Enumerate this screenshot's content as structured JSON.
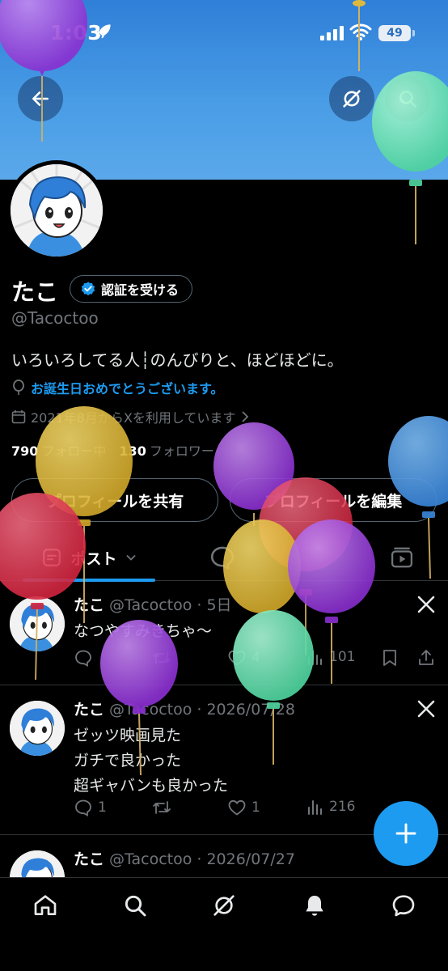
{
  "status": {
    "time": "1:03",
    "battery": "49"
  },
  "profile": {
    "name": "たこ",
    "verify_label": "認証を受ける",
    "handle": "@Tacoctoo",
    "bio": "いろいろしてる人┆のんびりと、ほどほどに。",
    "birthday": "お誕生日おめでとうございます。",
    "joined": "2021年8月からXを利用しています",
    "following_count": "790",
    "following_label": "フォロー中",
    "followers_count": "130",
    "followers_label": "フォロワー",
    "share_label": "プロフィールを共有",
    "edit_label": "プロフィールを編集"
  },
  "tabs": {
    "posts_label": "ポスト"
  },
  "tweets": [
    {
      "name": "たこ",
      "meta": "@Tacoctoo · 5日",
      "lines": [
        "なつやすみきちゃ〜"
      ],
      "views": "101",
      "likes": "4"
    },
    {
      "name": "たこ",
      "meta": "@Tacoctoo · 2026/07/28",
      "lines": [
        "ゼッツ映画見た",
        "ガチで良かった",
        "超ギャバンも良かった"
      ],
      "replies": "1",
      "likes": "1",
      "views": "216"
    },
    {
      "name": "たこ",
      "meta": "@Tacoctoo · 2026/07/27"
    }
  ],
  "colors": {
    "accent": "#1d9bf0",
    "banner": "#4a9ee6",
    "background": "#000000"
  },
  "icons": [
    "back-arrow-icon",
    "grok-icon",
    "search-icon",
    "verified-badge-icon",
    "balloon-icon",
    "calendar-icon",
    "chevron-right-icon",
    "posts-icon",
    "chevron-down-icon",
    "replies-icon",
    "media-icon",
    "x-logo-icon",
    "reply-icon",
    "retweet-icon",
    "like-icon",
    "views-icon",
    "bookmark-icon",
    "share-icon",
    "plus-icon",
    "home-icon",
    "grok-nav-icon",
    "bell-icon",
    "messages-icon"
  ]
}
